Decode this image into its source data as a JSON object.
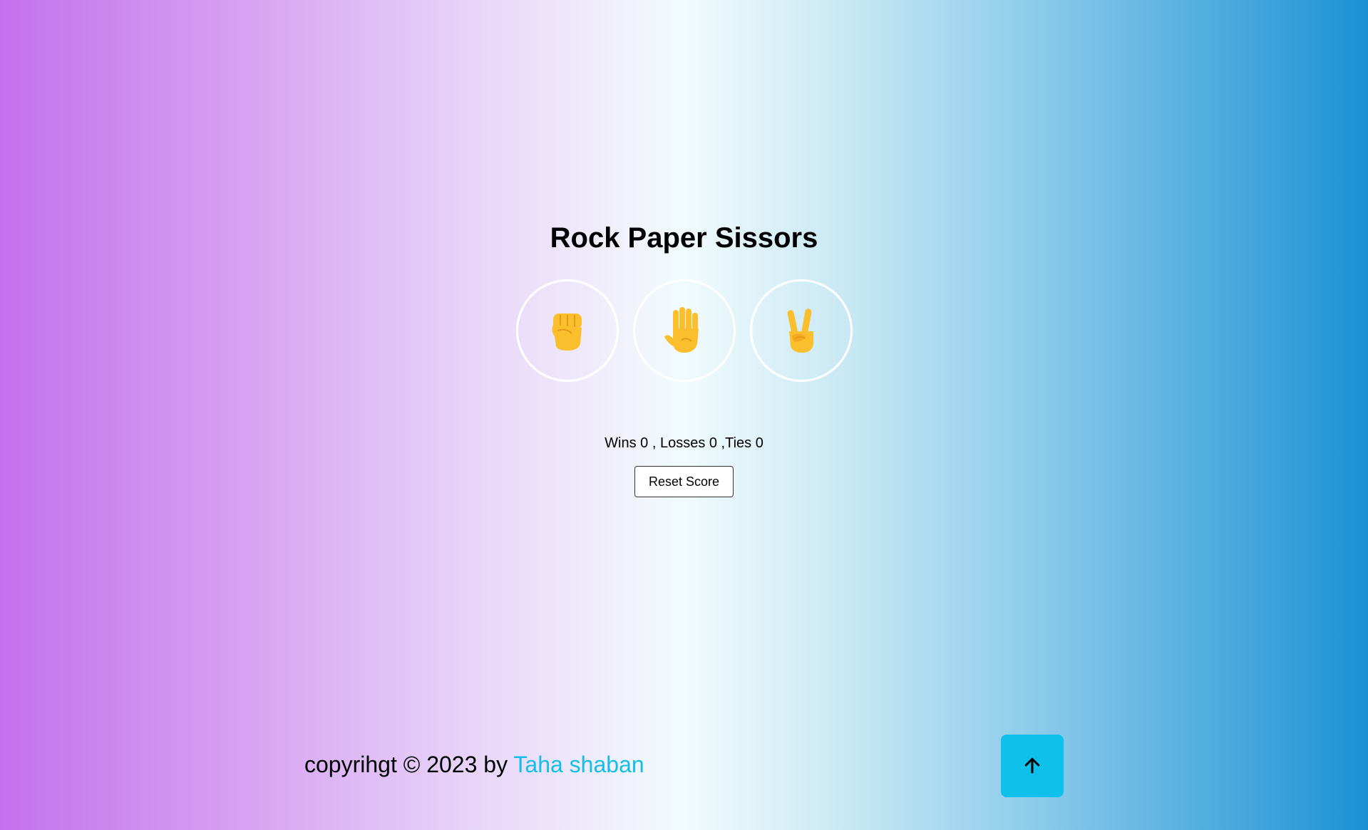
{
  "game": {
    "title": "Rock Paper Sissors",
    "choices": [
      {
        "name": "rock",
        "icon": "raised-fist-icon"
      },
      {
        "name": "paper",
        "icon": "raised-hand-icon"
      },
      {
        "name": "scissors",
        "icon": "victory-hand-icon"
      }
    ],
    "score_text": "Wins 0 , Losses 0 ,Ties 0",
    "reset_label": "Reset Score"
  },
  "footer": {
    "prefix": "copyrihgt © 2023 by ",
    "author": "Taha shaban"
  },
  "scroll_top": {
    "icon": "arrow-up-icon"
  },
  "colors": {
    "gradient_left": "#c471ed",
    "gradient_right": "#1b91d3",
    "accent": "#13bfe6",
    "emoji_skin": "#fbbf2d"
  }
}
